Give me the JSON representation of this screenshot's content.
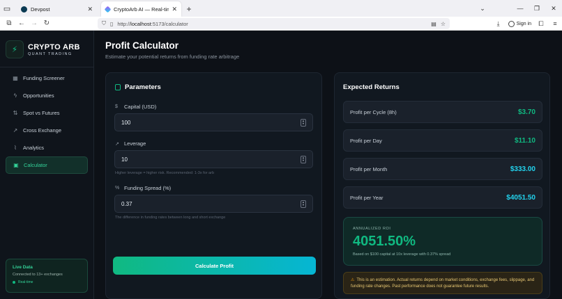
{
  "browser": {
    "tabs": [
      {
        "label": "Devpost",
        "active": false
      },
      {
        "label": "CryptoArb AI — Real-time Cryp",
        "active": true
      }
    ],
    "url_prefix": "http://",
    "url_host": "localhost",
    "url_path": ":5173/calculator",
    "sign_in": "Sign in"
  },
  "sidebar": {
    "logo_title": "CRYPTO ARB",
    "logo_sub": "QUANT TRADING",
    "items": [
      {
        "label": "Funding Screener",
        "icon": "grid-icon",
        "active": false
      },
      {
        "label": "Opportunities",
        "icon": "bolt-icon",
        "active": false
      },
      {
        "label": "Spot vs Futures",
        "icon": "arrows-icon",
        "active": false
      },
      {
        "label": "Cross Exchange",
        "icon": "trend-icon",
        "active": false
      },
      {
        "label": "Analytics",
        "icon": "chart-icon",
        "active": false
      },
      {
        "label": "Calculator",
        "icon": "calculator-icon",
        "active": true
      }
    ],
    "live": {
      "title": "Live Data",
      "subtitle": "Connected to 13+ exchanges",
      "status": "Real-time"
    }
  },
  "main": {
    "title": "Profit Calculator",
    "subtitle": "Estimate your potential returns from funding rate arbitrage",
    "params": {
      "title": "Parameters",
      "capital_label": "Capital (USD)",
      "capital_value": "100",
      "leverage_label": "Leverage",
      "leverage_value": "10",
      "leverage_hint": "Higher leverage = higher risk. Recommended: 1-3x for arb",
      "spread_label": "Funding Spread (%)",
      "spread_value": "0.37",
      "spread_hint": "The difference in funding rates between long and short exchange",
      "button": "Calculate Profit"
    },
    "returns": {
      "title": "Expected Returns",
      "rows": [
        {
          "label": "Profit per Cycle (8h)",
          "value": "$3.70",
          "color": "#10b981"
        },
        {
          "label": "Profit per Day",
          "value": "$11.10",
          "color": "#10b981"
        },
        {
          "label": "Profit per Month",
          "value": "$333.00",
          "color": "#22d3ee"
        },
        {
          "label": "Profit per Year",
          "value": "$4051.50",
          "color": "#22d3ee"
        }
      ],
      "roi_label": "ANNUALIZED ROI",
      "roi_value": "4051.50%",
      "roi_note": "Based on $100 capital at 10x leverage with 0.37% spread",
      "warning": "This is an estimation. Actual returns depend on market conditions, exchange fees, slippage, and funding rate changes. Past performance does not guarantee future results."
    }
  }
}
